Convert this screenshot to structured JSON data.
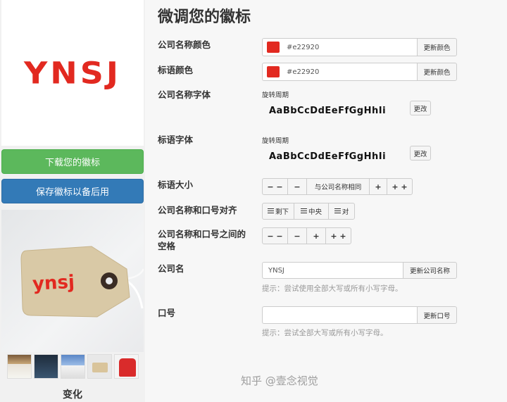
{
  "left": {
    "logo_text": "YNSJ",
    "logo_color": "#e22920",
    "download_button": "下载您的徽标",
    "save_button": "保存徽标以备后用",
    "tag_logo_text": "ynsj",
    "variation_label": "变化"
  },
  "editor": {
    "title": "微调您的徽标",
    "company_color": {
      "label": "公司名称颜色",
      "value": "#e22920",
      "button": "更新颜色"
    },
    "slogan_color": {
      "label": "标语颜色",
      "value": "#e22920",
      "button": "更新颜色"
    },
    "company_font": {
      "label": "公司名称字体",
      "font_name": "旋转周期",
      "sample": "AaBbCcDdEeFfGgHhIi",
      "button": "更改"
    },
    "slogan_font": {
      "label": "标语字体",
      "font_name": "旋转周期",
      "sample": "AaBbCcDdEeFfGgHhIi",
      "button": "更改"
    },
    "slogan_size": {
      "label": "标语大小",
      "buttons": [
        "− −",
        "−",
        "与公司名称相同",
        "+",
        "+ +"
      ]
    },
    "alignment": {
      "label": "公司名称和口号对齐",
      "buttons": [
        "剩下",
        "中央",
        "对"
      ]
    },
    "spacing": {
      "label": "公司名称和口号之间的",
      "label2": "空格",
      "buttons": [
        "− −",
        "−",
        "+",
        "+ +"
      ]
    },
    "company_name": {
      "label": "公司名",
      "value": "YNSJ",
      "button": "更新公司名称",
      "hint": "提示：尝试使用全部大写或所有小写字母。"
    },
    "slogan": {
      "label": "口号",
      "value": "",
      "button": "更新口号",
      "hint": "提示：尝试全部大写或所有小写字母。"
    }
  },
  "watermark": "知乎 @壹念视觉"
}
